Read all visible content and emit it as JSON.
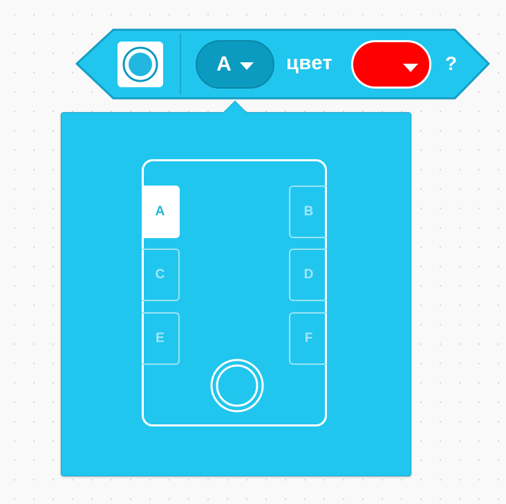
{
  "block": {
    "sensor_icon": "color-sensor-icon",
    "port_value": "A",
    "label": "цвет",
    "color_value": "#ff0000",
    "question": "?",
    "colors": {
      "block_fill": "#21c6ee",
      "block_stroke": "#159ec4",
      "port_dropdown": "#0b9ac0",
      "color_red": "#ff0000"
    }
  },
  "port_picker": {
    "selected": "A",
    "ports_left": [
      "A",
      "C",
      "E"
    ],
    "ports_right": [
      "B",
      "D",
      "F"
    ],
    "hub_button_icon": "hub-center-button-icon"
  }
}
